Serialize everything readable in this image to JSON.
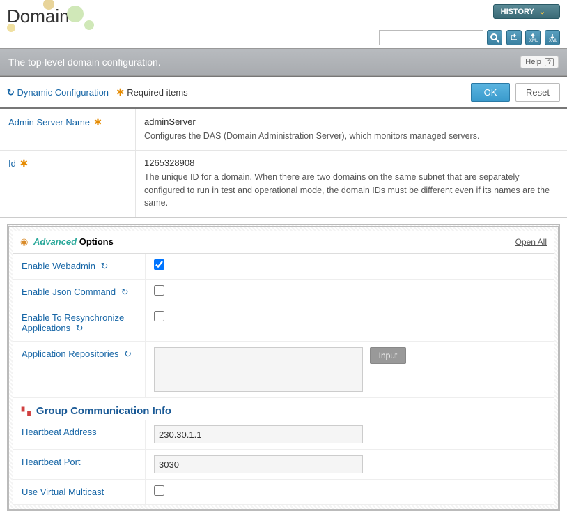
{
  "page_title": "Domain",
  "history_label": "HISTORY",
  "subtitle": "The top-level domain configuration.",
  "help_label": "Help",
  "legend": {
    "dynamic": "Dynamic Configuration",
    "required": "Required items"
  },
  "buttons": {
    "ok": "OK",
    "reset": "Reset",
    "input": "Input",
    "open_all": "Open All"
  },
  "search": {
    "placeholder": ""
  },
  "fields": {
    "admin_server": {
      "label": "Admin Server Name",
      "value": "adminServer",
      "desc": "Configures the DAS (Domain Administration Server), which monitors managed servers."
    },
    "id": {
      "label": "Id",
      "value": "1265328908",
      "desc": "The unique ID for a domain. When there are two domains on the same subnet that are separately configured to run in test and operational mode, the domain IDs must be different even if its names are the same."
    }
  },
  "advanced": {
    "title_adv": "Advanced",
    "title_opt": " Options",
    "enable_webadmin": {
      "label": "Enable Webadmin",
      "checked": true
    },
    "enable_json": {
      "label": "Enable Json Command",
      "checked": false
    },
    "enable_resync": {
      "label": "Enable To Resynchronize Applications",
      "checked": false
    },
    "app_repos": {
      "label": "Application Repositories",
      "value": ""
    },
    "group_comm_title": "Group Communication Info",
    "heartbeat_addr": {
      "label": "Heartbeat Address",
      "value": "230.30.1.1"
    },
    "heartbeat_port": {
      "label": "Heartbeat Port",
      "value": "3030"
    },
    "use_virtual_multicast": {
      "label": "Use Virtual Multicast",
      "checked": false
    }
  }
}
